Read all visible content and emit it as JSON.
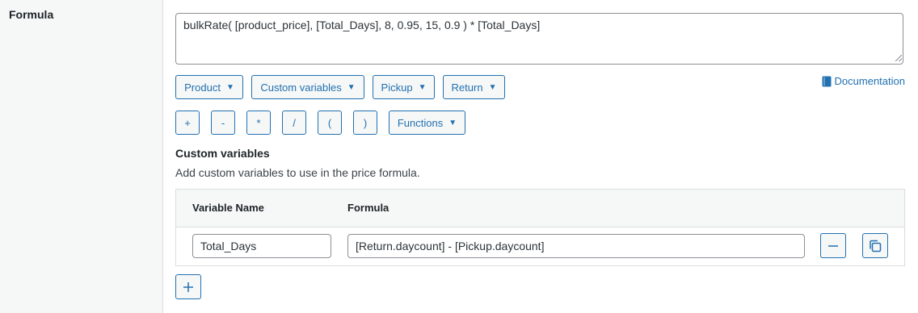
{
  "field": {
    "title": "Formula"
  },
  "formula": {
    "value": "bulkRate( [product_price], [Total_Days], 8, 0.95, 15, 0.9 ) * [Total_Days]"
  },
  "dropdowns": [
    {
      "label": "Product"
    },
    {
      "label": "Custom variables"
    },
    {
      "label": "Pickup"
    },
    {
      "label": "Return"
    }
  ],
  "documentation": {
    "label": "Documentation",
    "icon": "book-icon"
  },
  "operators": [
    {
      "label": "+"
    },
    {
      "label": "-"
    },
    {
      "label": "*"
    },
    {
      "label": "/"
    },
    {
      "label": "("
    },
    {
      "label": ")"
    }
  ],
  "functions_dropdown": {
    "label": "Functions"
  },
  "custom_variables": {
    "title": "Custom variables",
    "description": "Add custom variables to use in the price formula.",
    "columns": {
      "name": "Variable Name",
      "formula": "Formula"
    },
    "rows": [
      {
        "name": "Total_Days",
        "formula": "[Return.daycount] - [Pickup.daycount]"
      }
    ]
  },
  "colors": {
    "accent": "#2271b1",
    "border": "#8c8f94",
    "label_bg": "#f6f7f7"
  }
}
